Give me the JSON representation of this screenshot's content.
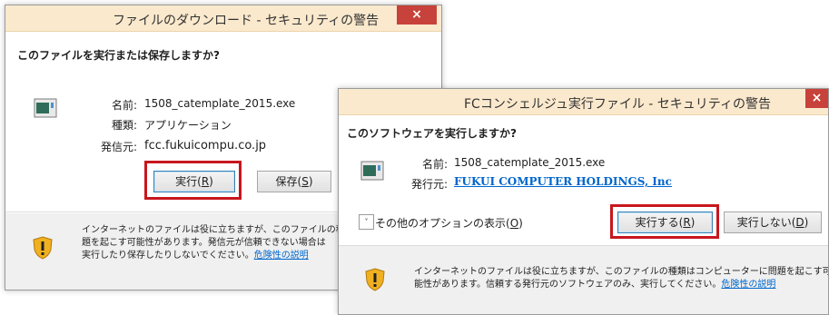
{
  "dialog1": {
    "title": "ファイルのダウンロード - セキュリティの警告",
    "close": "×",
    "question": "このファイルを実行または保存しますか?",
    "fields": [
      {
        "label": "名前:",
        "value": "1508_catemplate_2015.exe"
      },
      {
        "label": "種類:",
        "value": "アプリケーション"
      },
      {
        "label": "発信元:",
        "value": "fcc.fukuicompu.co.jp"
      }
    ],
    "run_button": {
      "text": "実行(",
      "key": "R",
      "end": ")"
    },
    "save_button": {
      "text": "保存(",
      "key": "S",
      "end": ")"
    },
    "warning_line1": "インターネットのファイルは役に立ちますが、このファイルの種類は",
    "warning_line2": "題を起こす可能性があります。発信元が信頼できない場合は",
    "warning_line3": "実行したり保存したりしないでください。",
    "warning_link": "危険性の説明"
  },
  "dialog2": {
    "title": "FCコンシェルジュ実行ファイル - セキュリティの警告",
    "close": "×",
    "question": "このソフトウェアを実行しますか?",
    "fields": [
      {
        "label": "名前:",
        "value": "1508_catemplate_2015.exe"
      },
      {
        "label": "発行元:",
        "value": "FUKUI COMPUTER HOLDINGS, Inc"
      }
    ],
    "options_chevron": "˅",
    "options": {
      "text": "その他のオプションの表示(",
      "key": "O",
      "end": ")"
    },
    "run_button": {
      "text": "実行する(",
      "key": "R",
      "end": ")"
    },
    "norun_button": {
      "text": "実行しない(",
      "key": "D",
      "end": ")"
    },
    "warning_line1": "インターネットのファイルは役に立ちますが、このファイルの種類はコンピューターに問題を起こす可",
    "warning_line2": "能性があります。信頼する発行元のソフトウェアのみ、実行してください。",
    "warning_link": "危険性の説明"
  },
  "colors": {
    "titlebar": "#fbe9cd",
    "close": "#c7423a",
    "highlight": "#c8161d",
    "link": "#0066cc"
  }
}
